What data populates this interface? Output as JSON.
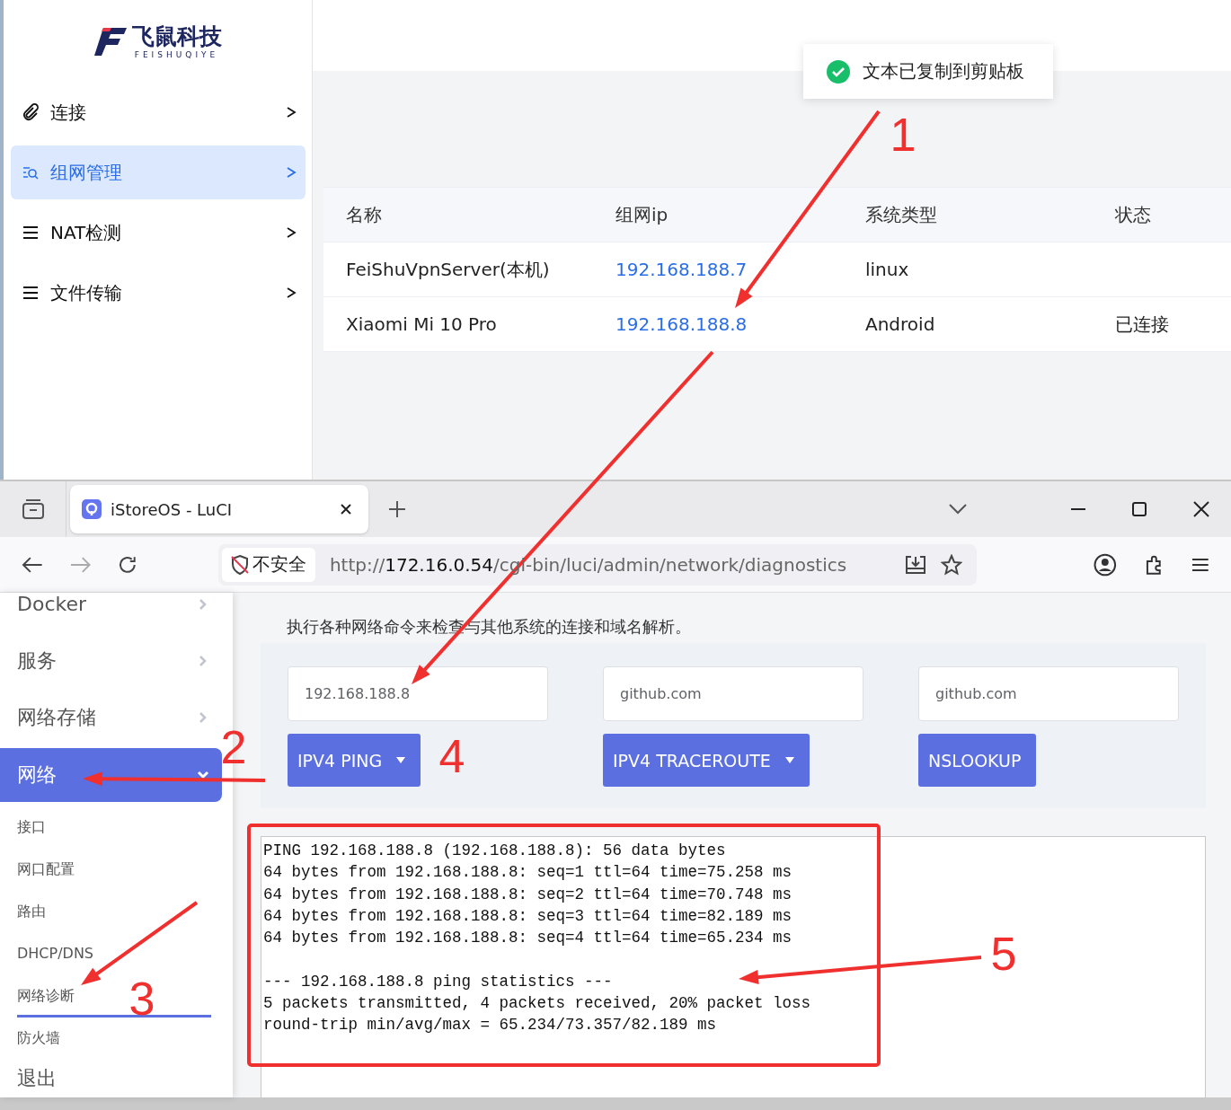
{
  "app": {
    "logo": {
      "name": "飞鼠科技",
      "subtitle": "FEISHUQIYE"
    },
    "nav": [
      {
        "label": "连接",
        "kind": "link",
        "selected": false
      },
      {
        "label": "组网管理",
        "kind": "search",
        "selected": true
      },
      {
        "label": "NAT检测",
        "kind": "menu",
        "selected": false
      },
      {
        "label": "文件传输",
        "kind": "menu",
        "selected": false
      }
    ],
    "toast": {
      "text": "文本已复制到剪贴板"
    },
    "table": {
      "columns": [
        "名称",
        "组网ip",
        "系统类型",
        "状态"
      ],
      "rows": [
        {
          "name": "FeiShuVpnServer(本机)",
          "ip": "192.168.188.7",
          "os": "linux"
        },
        {
          "name": "Xiaomi Mi 10 Pro",
          "ip": "192.168.188.8",
          "os": "Android",
          "status": "已连接"
        }
      ]
    }
  },
  "browser": {
    "tab": {
      "title": "iStoreOS - LuCI"
    },
    "security": "不安全",
    "url": {
      "scheme": "http://",
      "host": "172.16.0.54",
      "path": "/cgi-bin/luci/admin/network/diagnostics"
    }
  },
  "luci": {
    "menu": [
      {
        "label": "Docker",
        "kind": "group",
        "expanded": false,
        "selected": false
      },
      {
        "label": "服务",
        "kind": "group",
        "expanded": false,
        "selected": false
      },
      {
        "label": "网络存储",
        "kind": "group",
        "expanded": false,
        "selected": false
      },
      {
        "label": "网络",
        "kind": "group",
        "expanded": true,
        "selected": true
      },
      {
        "label": "接口",
        "kind": "sub",
        "selected": false
      },
      {
        "label": "网口配置",
        "kind": "sub",
        "selected": false
      },
      {
        "label": "路由",
        "kind": "sub",
        "selected": false
      },
      {
        "label": "DHCP/DNS",
        "kind": "sub",
        "selected": false
      },
      {
        "label": "网络诊断",
        "kind": "sub",
        "selected": true
      },
      {
        "label": "防火墙",
        "kind": "sub",
        "selected": false
      },
      {
        "label": "退出",
        "kind": "link",
        "selected": false
      }
    ],
    "description": "执行各种网络命令来检查与其他系统的连接和域名解析。",
    "tools": [
      {
        "value": "192.168.188.8",
        "button": "IPV4 PING",
        "dropdown": true
      },
      {
        "value": "github.com",
        "button": "IPV4 TRACEROUTE",
        "dropdown": true
      },
      {
        "value": "github.com",
        "button": "NSLOOKUP",
        "dropdown": false
      }
    ],
    "output": [
      [
        "PING 192.168.188.8 (192.168.188.8): 56 data bytes",
        "64 bytes from 192.168.188.8: seq=1 ttl=64 time=75.258 ms",
        "64 bytes from 192.168.188.8: seq=2 ttl=64 time=70.748 ms",
        "64 bytes from 192.168.188.8: seq=3 ttl=64 time=82.189 ms",
        "64 bytes from 192.168.188.8: seq=4 ttl=64 time=65.234 ms"
      ],
      [
        "--- 192.168.188.8 ping statistics ---",
        "5 packets transmitted, 4 packets received, 20% packet loss",
        "round-trip min/avg/max = 65.234/73.357/82.189 ms"
      ]
    ]
  },
  "annotations": [
    {
      "label": "1"
    },
    {
      "label": "2"
    },
    {
      "label": "3"
    },
    {
      "label": "4"
    },
    {
      "label": "5"
    }
  ]
}
